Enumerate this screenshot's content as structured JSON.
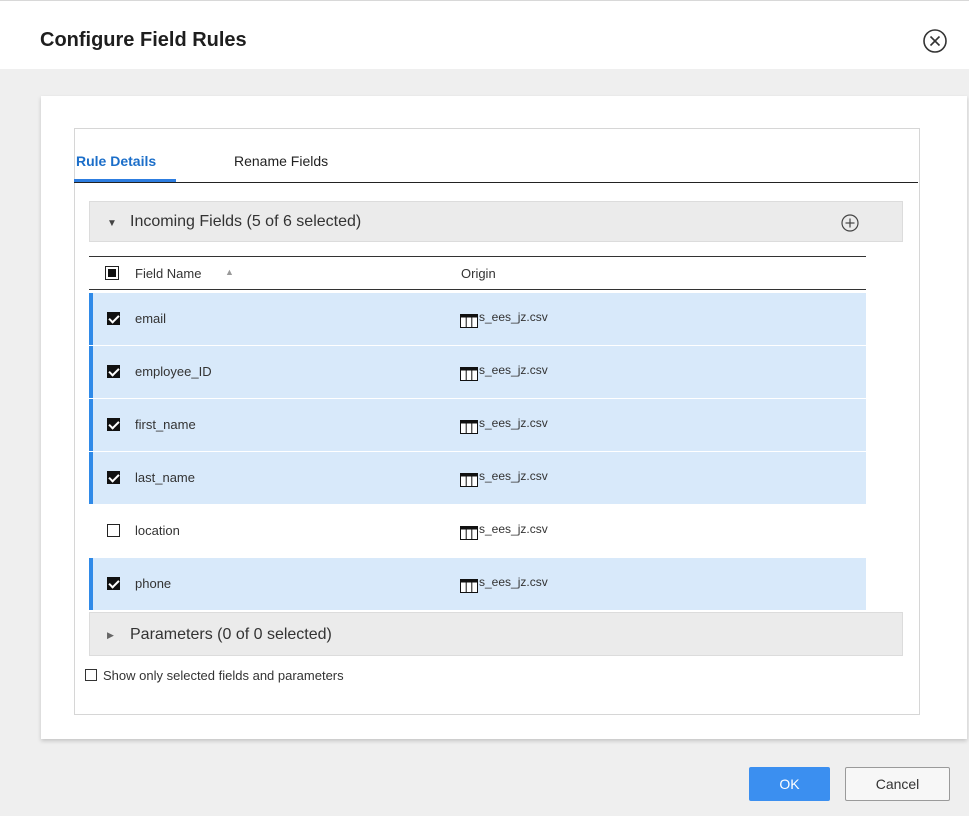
{
  "dialog": {
    "title": "Configure Field Rules"
  },
  "tabs": [
    {
      "label": "Rule Details",
      "active": true
    },
    {
      "label": "Rename Fields",
      "active": false
    }
  ],
  "incoming": {
    "title": "Incoming Fields (5 of 6 selected)",
    "expanded": true
  },
  "table": {
    "columns": {
      "name": "Field Name",
      "origin": "Origin"
    },
    "rows": [
      {
        "name": "email",
        "origin": "s_ees_jz.csv",
        "checked": true
      },
      {
        "name": "employee_ID",
        "origin": "s_ees_jz.csv",
        "checked": true
      },
      {
        "name": "first_name",
        "origin": "s_ees_jz.csv",
        "checked": true
      },
      {
        "name": "last_name",
        "origin": "s_ees_jz.csv",
        "checked": true
      },
      {
        "name": "location",
        "origin": "s_ees_jz.csv",
        "checked": false
      },
      {
        "name": "phone",
        "origin": "s_ees_jz.csv",
        "checked": true
      }
    ]
  },
  "parameters": {
    "title": "Parameters (0 of 0 selected)",
    "expanded": false
  },
  "show_only": {
    "label": "Show only selected fields and parameters",
    "checked": false
  },
  "buttons": {
    "ok": "OK",
    "cancel": "Cancel"
  },
  "colors": {
    "accent": "#3b8ff0",
    "selected_row": "#d8e9fa",
    "tab_active": "#1b6ec9"
  },
  "icons": {
    "close": "close-circle-icon",
    "add": "add-circle-icon",
    "expand": "caret-down-icon",
    "collapse": "caret-right-icon",
    "sort": "sort-ascending-icon",
    "origin": "table-icon"
  }
}
